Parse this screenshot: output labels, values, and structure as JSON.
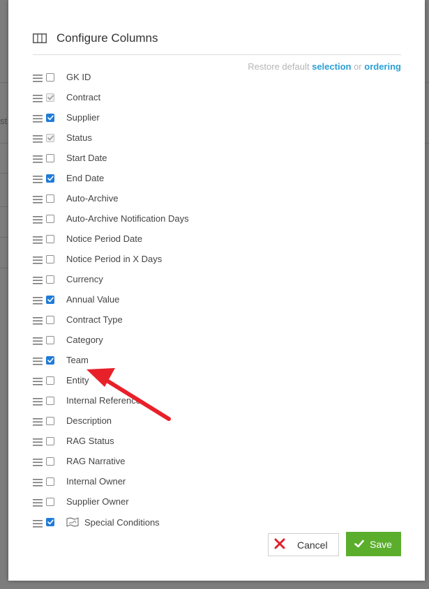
{
  "dialog": {
    "title": "Configure Columns",
    "icon": "columns-icon"
  },
  "restore": {
    "prefix": "Restore default",
    "selection_link": "selection",
    "or_text": "or",
    "ordering_link": "ordering"
  },
  "columns": [
    {
      "label": "GK ID",
      "checked": false,
      "disabled": false
    },
    {
      "label": "Contract",
      "checked": true,
      "disabled": true
    },
    {
      "label": "Supplier",
      "checked": true,
      "disabled": false
    },
    {
      "label": "Status",
      "checked": true,
      "disabled": true
    },
    {
      "label": "Start Date",
      "checked": false,
      "disabled": false
    },
    {
      "label": "End Date",
      "checked": true,
      "disabled": false
    },
    {
      "label": "Auto-Archive",
      "checked": false,
      "disabled": false
    },
    {
      "label": "Auto-Archive Notification Days",
      "checked": false,
      "disabled": false
    },
    {
      "label": "Notice Period Date",
      "checked": false,
      "disabled": false
    },
    {
      "label": "Notice Period in X Days",
      "checked": false,
      "disabled": false
    },
    {
      "label": "Currency",
      "checked": false,
      "disabled": false
    },
    {
      "label": "Annual Value",
      "checked": true,
      "disabled": false
    },
    {
      "label": "Contract Type",
      "checked": false,
      "disabled": false
    },
    {
      "label": "Category",
      "checked": false,
      "disabled": false
    },
    {
      "label": "Team",
      "checked": true,
      "disabled": false
    },
    {
      "label": "Entity",
      "checked": false,
      "disabled": false
    },
    {
      "label": "Internal Reference",
      "checked": false,
      "disabled": false
    },
    {
      "label": "Description",
      "checked": false,
      "disabled": false
    },
    {
      "label": "RAG Status",
      "checked": false,
      "disabled": false
    },
    {
      "label": "RAG Narrative",
      "checked": false,
      "disabled": false
    },
    {
      "label": "Internal Owner",
      "checked": false,
      "disabled": false
    },
    {
      "label": "Supplier Owner",
      "checked": false,
      "disabled": false
    },
    {
      "label": "Special Conditions",
      "checked": true,
      "disabled": false,
      "icon": "map-icon"
    }
  ],
  "buttons": {
    "cancel_label": "Cancel",
    "save_label": "Save"
  },
  "backdrop": {
    "partial_text": "st"
  },
  "colors": {
    "accent_blue": "#2a9fd6",
    "checkbox_blue": "#1f7bd8",
    "save_green": "#5bae2c",
    "cancel_red": "#e0202a",
    "annotation_arrow": "#e8202a"
  },
  "annotation": {
    "type": "arrow",
    "points_to": "Team"
  }
}
